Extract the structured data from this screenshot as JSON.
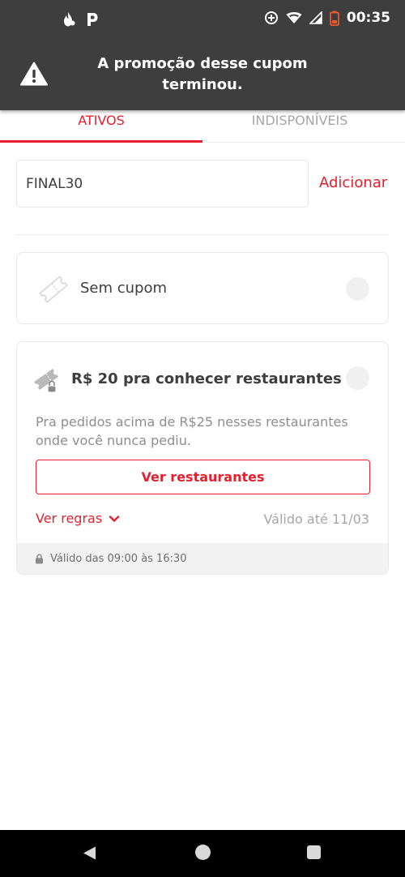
{
  "status_bar": {
    "time": "00:35",
    "icons_left": [
      "fire-notification-icon",
      "parking-notification-icon"
    ],
    "icons_right": [
      "data-saver-icon",
      "wifi-icon",
      "signal-icon",
      "battery-low-icon"
    ]
  },
  "toast": {
    "icon": "warning-icon",
    "message": "A promoção desse cupom terminou."
  },
  "tabs": {
    "active": "ATIVOS",
    "inactive": "INDISPONÍVEIS"
  },
  "coupon_entry": {
    "value": "FINAL30",
    "add_label": "Adicionar"
  },
  "no_coupon": {
    "icon": "ticket-icon",
    "label": "Sem cupom"
  },
  "offer": {
    "icon": "ticket-lock-icon",
    "title": "R$ 20 pra conhecer restaurantes",
    "description": "Pra pedidos acima de R$25 nesses restaurantes onde você nunca pediu.",
    "button_label": "Ver restaurantes",
    "rules_label": "Ver regras",
    "valid_until": "Válido até 11/03",
    "schedule": "Válido das 09:00 às 16:30"
  },
  "colors": {
    "accent": "#ea1d2c",
    "toast_bg": "#3e3e3e",
    "muted_text": "#a6a6a6"
  }
}
